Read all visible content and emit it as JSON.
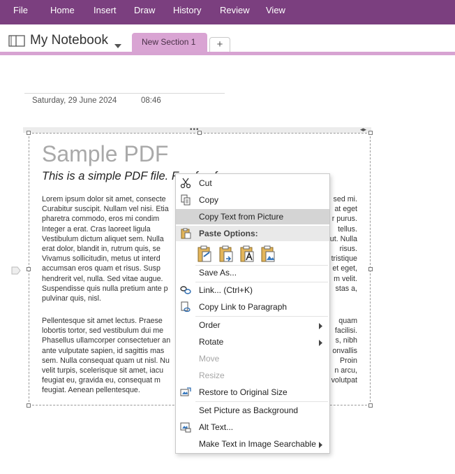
{
  "menubar": {
    "items": [
      "File",
      "Home",
      "Insert",
      "Draw",
      "History",
      "Review",
      "View"
    ],
    "color": "#7b3f7f"
  },
  "notebook": {
    "title": "My Notebook",
    "active_tab": "New Section 1",
    "add_tab": "+",
    "accent": "#d9a4d3"
  },
  "page": {
    "date": "Saturday, 29 June 2024",
    "time": "08:46"
  },
  "pdf": {
    "title": "Sample PDF",
    "subtitle": "This is a simple PDF file. Fun fun fun.",
    "para1": [
      {
        "l": "Lorem ipsum dolor sit amet, consecte",
        "r": "sed mi."
      },
      {
        "l": "Curabitur suscipit. Nullam vel nisi. Etia",
        "r": "at eget"
      },
      {
        "l": "pharetra commodo, eros mi condim",
        "r": "r purus."
      },
      {
        "l": "Integer a erat. Cras laoreet ligula",
        "r": "tellus."
      },
      {
        "l": "Vestibulum dictum aliquet sem. Nulla",
        "r": "ut. Nulla"
      },
      {
        "l": "erat dolor, blandit in, rutrum quis, se",
        "r": "risus."
      },
      {
        "l": "Vivamus sollicitudin, metus ut interd",
        "r": "tristique"
      },
      {
        "l": "accumsan eros quam et risus. Susp",
        "r": "et eget,"
      },
      {
        "l": "hendrerit vel, nulla. Sed vitae augue.",
        "r": "m velit."
      },
      {
        "l": "Suspendisse quis nulla pretium ante p",
        "r": "stas a,"
      },
      {
        "l": "pulvinar quis, nisl.",
        "r": ""
      }
    ],
    "para2": [
      {
        "l": "Pellentesque sit amet lectus. Praese",
        "r": "quam"
      },
      {
        "l": "lobortis tortor, sed vestibulum dui me",
        "r": "facilisi."
      },
      {
        "l": "Phasellus ullamcorper consectetuer an",
        "r": "s, nibh"
      },
      {
        "l": "ante vulputate sapien, id sagittis mas",
        "r": "onvallis"
      },
      {
        "l": "sem. Nulla consequat quam ut nisl. Nu",
        "r": "Proin"
      },
      {
        "l": "velit turpis, scelerisque sit amet, iacu",
        "r": "n arcu,"
      },
      {
        "l": "feugiat eu, gravida eu, consequat m",
        "r": "volutpat"
      },
      {
        "l": "feugiat. Aenean pellentesque.",
        "r": ""
      }
    ]
  },
  "context_menu": {
    "cut": "Cut",
    "copy": "Copy",
    "copy_text": "Copy Text from Picture",
    "paste_options": "Paste Options:",
    "save_as": "Save As...",
    "link": "Link...  (Ctrl+K)",
    "copy_link": "Copy Link to Paragraph",
    "order": "Order",
    "rotate": "Rotate",
    "move": "Move",
    "resize": "Resize",
    "restore": "Restore to Original Size",
    "set_bg": "Set Picture as Background",
    "alt_text": "Alt Text...",
    "make_searchable": "Make Text in Image Searchable"
  }
}
